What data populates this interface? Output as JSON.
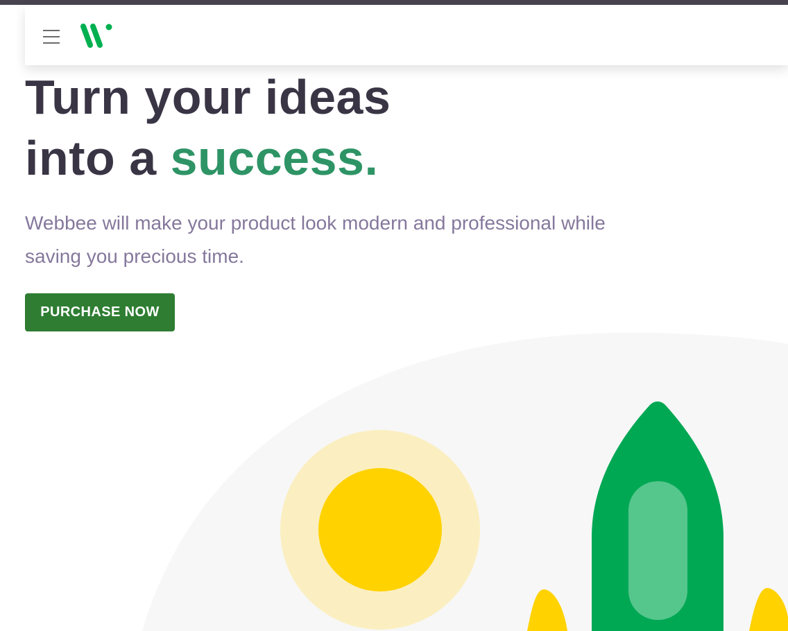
{
  "header": {
    "menu_icon": "hamburger-menu-icon",
    "logo_icon": "webbee-logo-icon"
  },
  "hero": {
    "title_line1": "Turn your ideas",
    "title_line2_prefix": "into a ",
    "title_line2_accent": "success.",
    "subtitle": "Webbee will make your product look modern and professional while saving you precious time.",
    "cta_label": "PURCHASE NOW"
  },
  "illustration": {
    "icons": [
      "sun-icon",
      "rocket-icon",
      "flame-icon"
    ]
  },
  "colors": {
    "top_strip": "#47434f",
    "heading": "#3a3545",
    "accent": "#2e9466",
    "subtitle": "#85789c",
    "button": "#2e7d32",
    "logo_green": "#00b050",
    "rocket_green": "#00a854",
    "sun_yellow": "#ffd200",
    "sun_halo": "#fbefc1",
    "backdrop": "#f7f7f7"
  }
}
